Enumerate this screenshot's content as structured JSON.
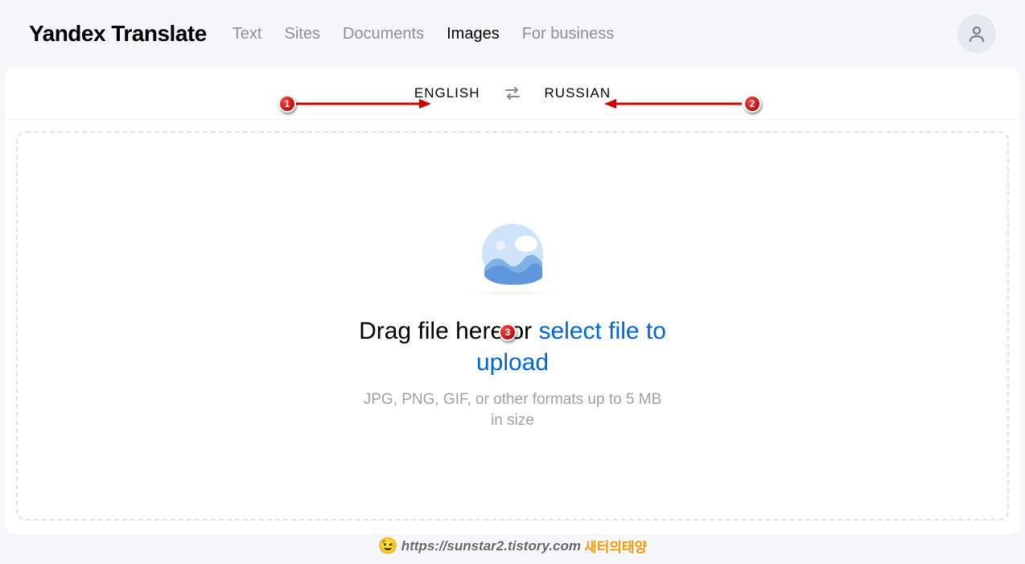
{
  "header": {
    "logo": "Yandex Translate",
    "nav": {
      "text": "Text",
      "sites": "Sites",
      "documents": "Documents",
      "images": "Images",
      "business": "For business"
    }
  },
  "langbar": {
    "source": "ENGLISH",
    "target": "RUSSIAN"
  },
  "drop": {
    "text_prefix": "Drag file here or ",
    "link": "select file to upload",
    "hint": "JPG, PNG, GIF, or other formats up to 5 MB in size"
  },
  "annotations": {
    "m1": "1",
    "m2": "2",
    "m3": "3"
  },
  "watermark": {
    "url": "https://sunstar2.tistory.com",
    "korean": "새터의태양"
  }
}
